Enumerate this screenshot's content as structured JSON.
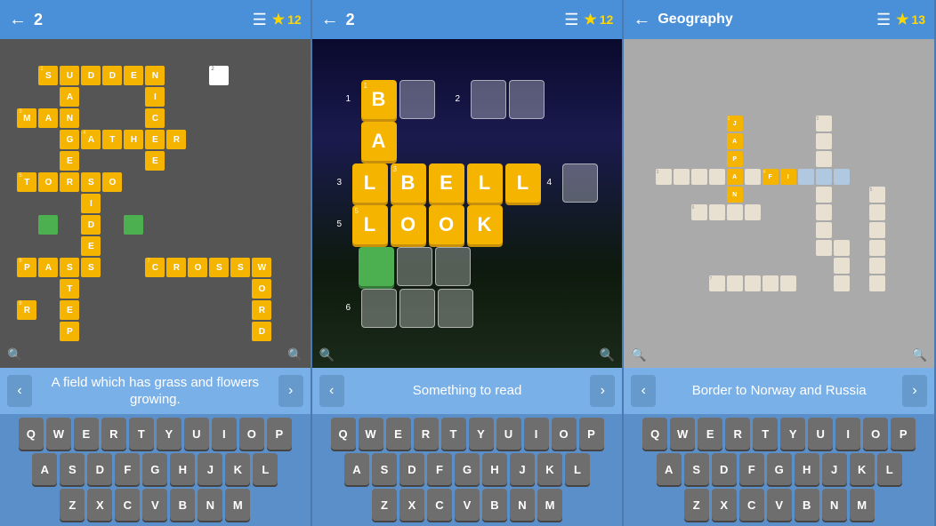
{
  "panels": [
    {
      "id": "panel1",
      "topbar": {
        "level": "2",
        "star_count": "12",
        "back_label": "←",
        "menu_label": "☰",
        "star_symbol": "★"
      },
      "hint": "A field which has grass and flowers growing.",
      "keyboard_rows": [
        [
          "Q",
          "W",
          "E",
          "R",
          "T",
          "Y",
          "U",
          "I",
          "O",
          "P"
        ],
        [
          "A",
          "S",
          "D",
          "F",
          "G",
          "H",
          "J",
          "K",
          "L"
        ],
        [
          "Z",
          "X",
          "C",
          "V",
          "B",
          "N",
          "M"
        ]
      ]
    },
    {
      "id": "panel2",
      "topbar": {
        "level": "2",
        "star_count": "12",
        "back_label": "←",
        "menu_label": "☰",
        "star_symbol": "★"
      },
      "hint": "Something to read",
      "keyboard_rows": [
        [
          "Q",
          "W",
          "E",
          "R",
          "T",
          "Y",
          "U",
          "I",
          "O",
          "P"
        ],
        [
          "A",
          "S",
          "D",
          "F",
          "G",
          "H",
          "J",
          "K",
          "L"
        ],
        [
          "Z",
          "X",
          "C",
          "V",
          "B",
          "N",
          "M"
        ]
      ]
    },
    {
      "id": "panel3",
      "topbar": {
        "title": "Geography",
        "star_count": "13",
        "back_label": "←",
        "menu_label": "☰",
        "star_symbol": "★"
      },
      "hint": "Border to Norway and Russia",
      "keyboard_rows": [
        [
          "Q",
          "W",
          "E",
          "R",
          "T",
          "Y",
          "U",
          "I",
          "O",
          "P"
        ],
        [
          "A",
          "S",
          "D",
          "F",
          "G",
          "H",
          "J",
          "K",
          "L"
        ],
        [
          "Z",
          "X",
          "C",
          "V",
          "B",
          "N",
          "M"
        ]
      ]
    }
  ]
}
